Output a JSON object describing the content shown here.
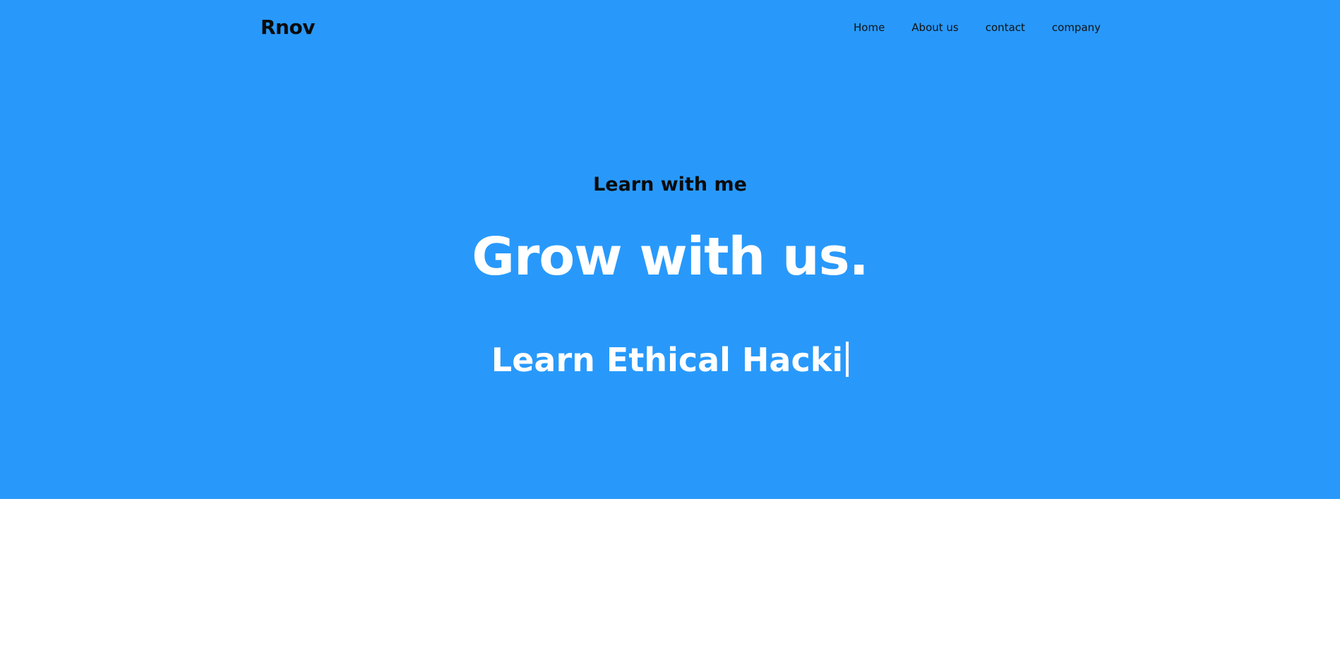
{
  "brand": {
    "name": "Rnov"
  },
  "nav": {
    "items": [
      {
        "label": "Home"
      },
      {
        "label": "About us"
      },
      {
        "label": "contact"
      },
      {
        "label": "company"
      }
    ]
  },
  "hero": {
    "subtitle": "Learn with me",
    "headline": "Grow with us.",
    "typed_text": "Learn Ethical Hacki"
  },
  "colors": {
    "hero_background": "#2899fb",
    "page_background": "#ffffff",
    "headline_text": "#ffffff",
    "subtitle_text": "#0b0b0b"
  }
}
